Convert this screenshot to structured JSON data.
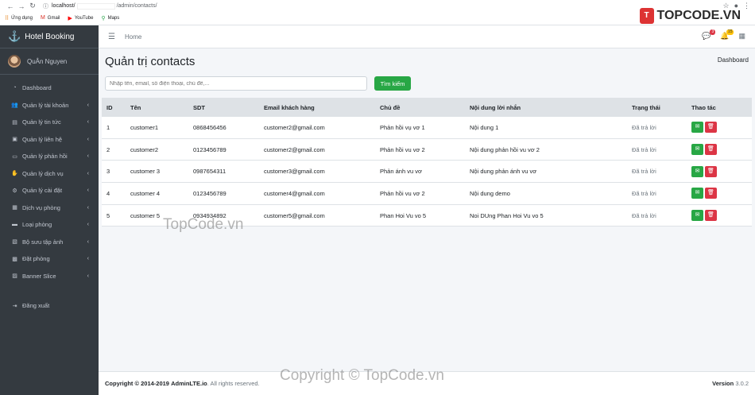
{
  "browser": {
    "url_host": "localhost/",
    "url_path": "/admin/contacts/",
    "bookmarks": [
      {
        "label": "Ứng dụng",
        "icon": "apps-icon"
      },
      {
        "label": "Gmail",
        "icon": "gmail-icon"
      },
      {
        "label": "YouTube",
        "icon": "youtube-icon"
      },
      {
        "label": "Maps",
        "icon": "maps-icon"
      }
    ]
  },
  "sidebar": {
    "brand": "Hotel Booking",
    "user": "QuÂn Nguyen",
    "items": [
      {
        "label": "Dashboard",
        "icon": "dashboard-icon",
        "chevron": false
      },
      {
        "label": "Quản lý tài khoản",
        "icon": "users-icon",
        "chevron": true
      },
      {
        "label": "Quản lý tin tức",
        "icon": "newspaper-icon",
        "chevron": true
      },
      {
        "label": "Quản lý liên hệ",
        "icon": "contact-icon",
        "chevron": true
      },
      {
        "label": "Quản lý phản hồi",
        "icon": "comment-icon",
        "chevron": true
      },
      {
        "label": "Quản lý dịch vụ",
        "icon": "handshake-icon",
        "chevron": true
      },
      {
        "label": "Quản lý cài đặt",
        "icon": "cogs-icon",
        "chevron": true
      },
      {
        "label": "Dịch vụ phòng",
        "icon": "file-icon",
        "chevron": true
      },
      {
        "label": "Loại phòng",
        "icon": "bed-icon",
        "chevron": true
      },
      {
        "label": "Bộ sưu tập ảnh",
        "icon": "images-icon",
        "chevron": true
      },
      {
        "label": "Đặt phòng",
        "icon": "calendar-icon",
        "chevron": true
      },
      {
        "label": "Banner Slice",
        "icon": "image-icon",
        "chevron": true
      }
    ],
    "logout": "Đăng xuất"
  },
  "navbar": {
    "home": "Home",
    "messages_count": "3",
    "notifications_count": "15"
  },
  "content": {
    "title": "Quản trị contacts",
    "breadcrumb": "Dashboard",
    "search_placeholder": "Nhập tên, email, số điện thoại, chủ đề,...",
    "search_button": "Tìm kiếm"
  },
  "table": {
    "headers": [
      "ID",
      "Tên",
      "SDT",
      "Email khách hàng",
      "Chủ đề",
      "Nội dung lời nhắn",
      "Trạng thái",
      "Thao tác"
    ],
    "rows": [
      {
        "id": "1",
        "name": "customer1",
        "phone": "0868456456",
        "email": "customer2@gmail.com",
        "subject": "Phản hồi vụ vơ 1",
        "message": "Nội dung 1",
        "status": "Đã trả lời"
      },
      {
        "id": "2",
        "name": "customer2",
        "phone": "0123456789",
        "email": "customer2@gmail.com",
        "subject": "Phản hồi vu vơ 2",
        "message": "Nội dung phản hồi vu vơ 2",
        "status": "Đã trả lời"
      },
      {
        "id": "3",
        "name": "customer 3",
        "phone": "0987654311",
        "email": "customer3@gmail.com",
        "subject": "Phản ánh vu vơ",
        "message": "Nội dung phản ánh vu vơ",
        "status": "Đã trả lời"
      },
      {
        "id": "4",
        "name": "customer 4",
        "phone": "0123456789",
        "email": "customer4@gmail.com",
        "subject": "Phản hồi vu vơ 2",
        "message": "Nội dung demo",
        "status": "Đã trả lời"
      },
      {
        "id": "5",
        "name": "customer 5",
        "phone": "0934934892",
        "email": "customer5@gmail.com",
        "subject": "Phan Hoi Vu vo 5",
        "message": "Noi DUng Phan Hoi Vu vo 5",
        "status": "Đã trả lời"
      }
    ]
  },
  "footer": {
    "copyright_prefix": "Copyright © 2014-2019",
    "brand": "AdminLTE.io",
    "suffix": ". All rights reserved.",
    "version_label": "Version",
    "version": "3.0.2"
  },
  "watermarks": {
    "logo_text": "TOPCODE.VN",
    "center": "TopCode.vn",
    "bottom": "Copyright © TopCode.vn"
  },
  "colors": {
    "sidebar_bg": "#343a40",
    "accent_green": "#28a745",
    "accent_red": "#dc3545"
  }
}
